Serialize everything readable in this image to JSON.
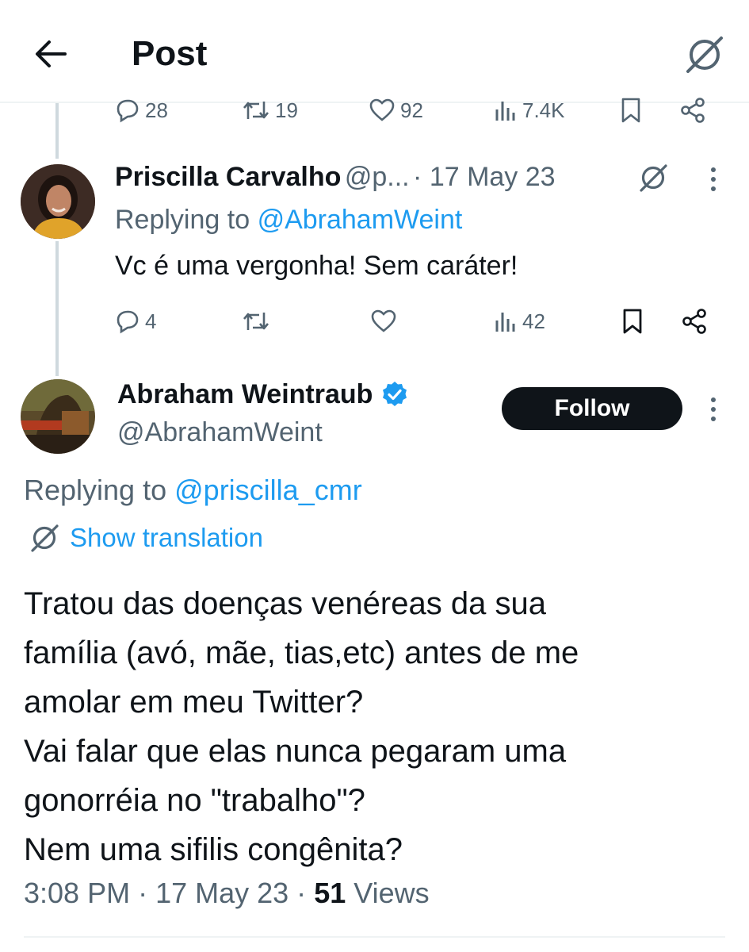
{
  "header": {
    "title": "Post"
  },
  "prev_tweet_actions": {
    "replies": "28",
    "retweets": "19",
    "likes": "92",
    "views": "7.4K"
  },
  "reply1": {
    "name": "Priscilla Carvalho",
    "handle": "@p...",
    "date": "· 17 May 23",
    "replying_prefix": "Replying to",
    "replying_handle": "@AbrahamWeint",
    "text": "Vc é uma vergonha! Sem caráter!",
    "actions": {
      "replies": "4",
      "views": "42"
    }
  },
  "main_tweet": {
    "name": "Abraham Weintraub",
    "handle": "@AbrahamWeint",
    "follow_label": "Follow",
    "replying_prefix": "Replying to",
    "replying_handle": "@priscilla_cmr",
    "translation_label": "Show translation",
    "text_lines": [
      "Tratou das doenças venéreas da sua",
      "família (avó, mãe, tias,etc) antes de me",
      "amolar em meu Twitter?",
      "Vai falar que elas nunca pegaram uma",
      "gonorréia no \"trabalho\"?",
      "Nem uma sifilis congênita?"
    ],
    "time": "3:08 PM",
    "date": "· 17 May 23 ·",
    "views_count": "51",
    "views_label": "Views"
  },
  "icons": {
    "back": "arrow-left-icon",
    "translate": "translate-icon",
    "reply": "reply-icon",
    "retweet": "retweet-icon",
    "like": "heart-icon",
    "views": "views-icon",
    "bookmark": "bookmark-icon",
    "share": "share-icon",
    "more": "more-vertical-icon",
    "verified": "verified-badge-icon"
  },
  "colors": {
    "link": "#1d9bf0",
    "muted": "#536471",
    "text": "#0f1419",
    "verified": "#1d9bf0"
  }
}
